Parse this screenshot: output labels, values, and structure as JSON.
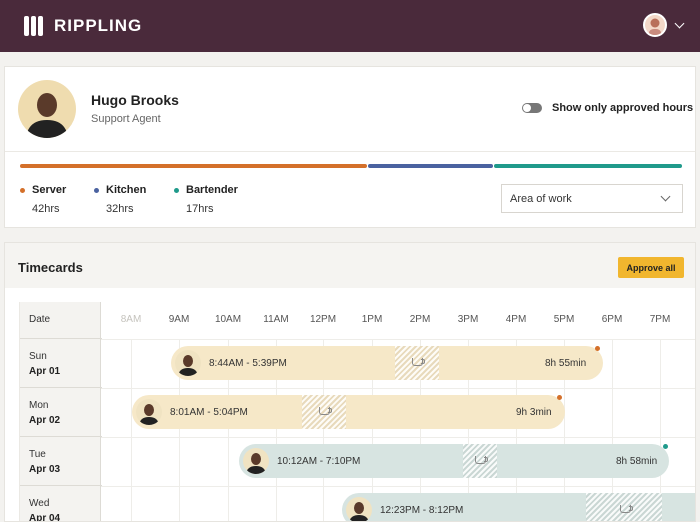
{
  "app": {
    "brand": "RIPPLING"
  },
  "colors": {
    "topbar": "#4a2a3b",
    "server": "#d4702a",
    "kitchen": "#4a62a0",
    "bartender": "#1f9a8b",
    "approve": "#f1b62e",
    "shift_server": "#f6e8c8",
    "shift_bartender": "#d7e4e1"
  },
  "profile": {
    "name": "Hugo Brooks",
    "role": "Support Agent",
    "toggle_label": "Show only approved hours",
    "toggle_on": false,
    "legend": [
      {
        "label": "Server",
        "hours": "42hrs"
      },
      {
        "label": "Kitchen",
        "hours": "32hrs"
      },
      {
        "label": "Bartender",
        "hours": "17hrs"
      }
    ],
    "select_value": "Area of work"
  },
  "timecards": {
    "title": "Timecards",
    "approve_label": "Approve all",
    "date_header": "Date",
    "hours": [
      "8AM",
      "9AM",
      "10AM",
      "11AM",
      "12PM",
      "1PM",
      "2PM",
      "3PM",
      "4PM",
      "5PM",
      "6PM",
      "7PM"
    ],
    "rows": [
      {
        "day": "Sun",
        "date": "Apr 01"
      },
      {
        "day": "Mon",
        "date": "Apr 02"
      },
      {
        "day": "Tue",
        "date": "Apr 03"
      },
      {
        "day": "Wed",
        "date": "Apr 04"
      }
    ],
    "shifts": [
      {
        "range": "8:44AM - 5:39PM",
        "duration": "8h 55min",
        "area": "Server"
      },
      {
        "range": "8:01AM - 5:04PM",
        "duration": "9h 3min",
        "area": "Server"
      },
      {
        "range": "10:12AM - 7:10PM",
        "duration": "8h 58min",
        "area": "Bartender"
      },
      {
        "range": "12:23PM - 8:12PM",
        "duration": "",
        "area": "Bartender"
      }
    ]
  }
}
